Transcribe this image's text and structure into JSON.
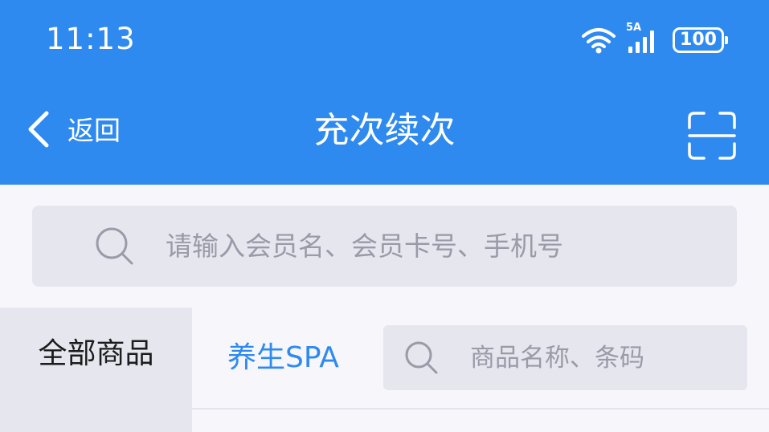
{
  "status_bar": {
    "time": "11:13",
    "network": "5A",
    "battery": "100"
  },
  "nav": {
    "back_label": "返回",
    "title": "充次续次",
    "scan_icon": "scan-icon"
  },
  "member_search": {
    "placeholder": "请输入会员名、会员卡号、手机号",
    "value": ""
  },
  "category_sidebar": {
    "items": [
      {
        "label": "全部商品",
        "selected": true
      }
    ]
  },
  "tabs": [
    {
      "label": "养生SPA",
      "active": true
    }
  ],
  "product_search": {
    "placeholder": "商品名称、条码",
    "value": ""
  },
  "colors": {
    "brand": "#2f8af0",
    "background": "#f7f7fb",
    "input_bg": "#e6e6ef",
    "placeholder": "#9a9aa8",
    "text": "#1c1c1c"
  }
}
